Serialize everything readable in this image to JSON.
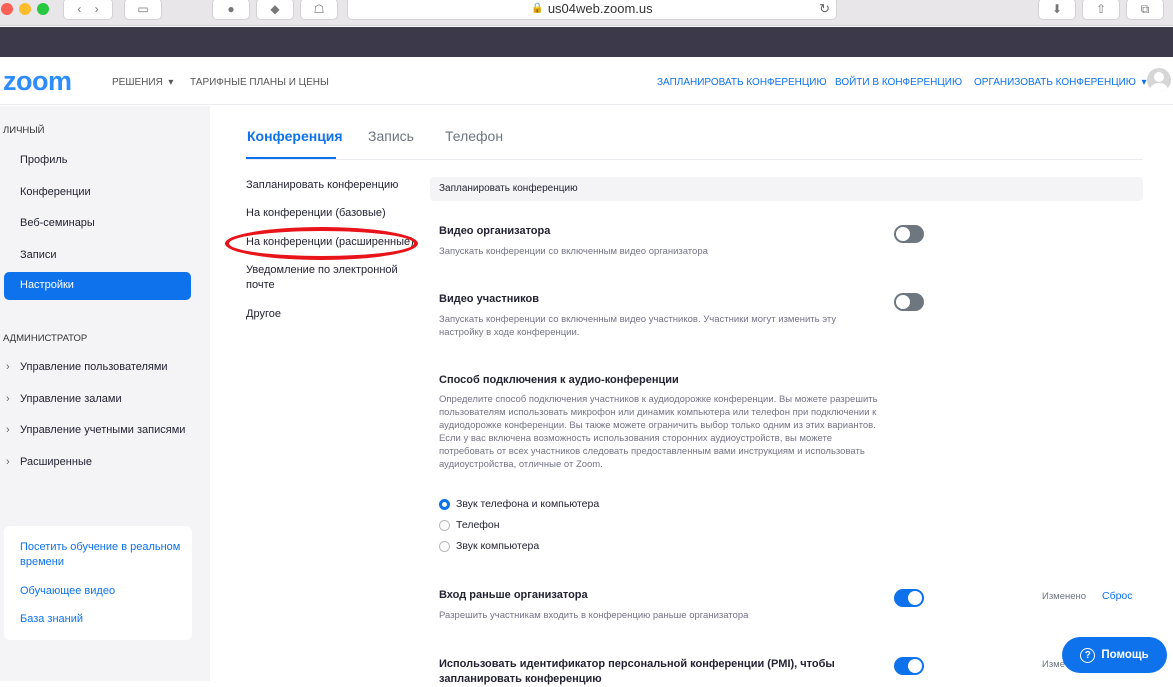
{
  "browser": {
    "url": "us04web.zoom.us"
  },
  "topnav": {
    "logo": "zoom",
    "solutions": "РЕШЕНИЯ",
    "plans": "ТАРИФНЫЕ ПЛАНЫ И ЦЕНЫ",
    "schedule": "ЗАПЛАНИРОВАТЬ КОНФЕРЕНЦИЮ",
    "join": "ВОЙТИ В КОНФЕРЕНЦИЮ",
    "host": "ОРГАНИЗОВАТЬ КОНФЕРЕНЦИЮ"
  },
  "sidebar": {
    "personal_title": "ЛИЧНЫЙ",
    "personal_items": [
      "Профиль",
      "Конференции",
      "Веб-семинары",
      "Записи",
      "Настройки"
    ],
    "admin_title": "АДМИНИСТРАТОР",
    "admin_items": [
      "Управление пользователями",
      "Управление залами",
      "Управление учетными записями",
      "Расширенные"
    ],
    "help_links": [
      "Посетить обучение в реальном времени",
      "Обучающее видео",
      "База знаний"
    ]
  },
  "tabs": [
    "Конференция",
    "Запись",
    "Телефон"
  ],
  "subnav": [
    "Запланировать конференцию",
    "На конференции (базовые)",
    "На конференции (расширенные)",
    "Уведомление по электронной почте",
    "Другое"
  ],
  "section_title": "Запланировать конференцию",
  "settings": {
    "host_video_title": "Видео организатора",
    "host_video_desc": "Запускать конференции со включенным видео организатора",
    "participant_video_title": "Видео участников",
    "participant_video_desc": "Запускать конференции со включенным видео участников. Участники могут изменить эту настройку в ходе конференции.",
    "audio_title": "Способ подключения к аудио-конференции",
    "audio_desc": "Определите способ подключения участников к аудиодорожке конференции. Вы можете разрешить пользователям использовать микрофон или динамик компьютера или телефон при подключении к аудиодорожке конференции. Вы также можете ограничить выбор только одним из этих вариантов. Если у вас включена возможность использования сторонних аудиоустройств, вы можете потребовать от всех участников следовать предоставленным вами инструкциям и использовать аудиоустройства, отличные от Zoom.",
    "audio_options": [
      "Звук телефона и компьютера",
      "Телефон",
      "Звук компьютера"
    ],
    "join_before_title": "Вход раньше организатора",
    "join_before_desc": "Разрешить участникам входить в конференцию раньше организатора",
    "changed_label": "Изменено",
    "reset_label": "Сброс",
    "pmi_title": "Использовать идентификатор персональной конференции (PMI), чтобы запланировать конференцию",
    "pmi_changed": "Изме"
  },
  "help_button": "Помощь"
}
